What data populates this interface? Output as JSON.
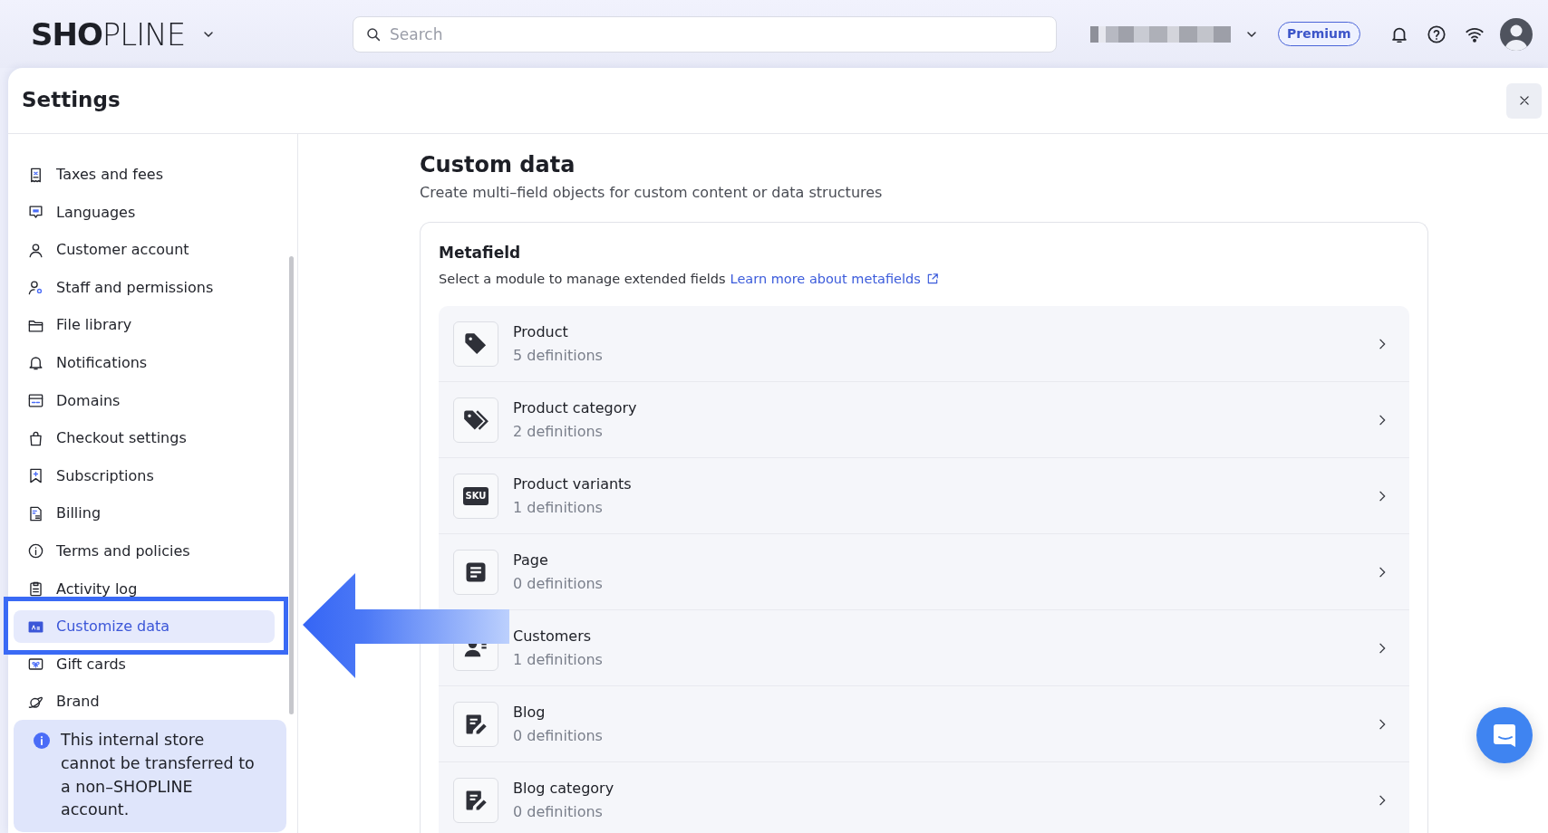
{
  "topbar": {
    "logo": "**SHO**PLINE",
    "search": {
      "placeholder": "Search"
    },
    "plan_badge": "Premium"
  },
  "settings": {
    "title": "Settings"
  },
  "sidebar": {
    "items": [
      {
        "label": "Taxes and fees",
        "selected": false
      },
      {
        "label": "Languages",
        "selected": false
      },
      {
        "label": "Customer account",
        "selected": false
      },
      {
        "label": "Staff and permissions",
        "selected": false
      },
      {
        "label": "File library",
        "selected": false
      },
      {
        "label": "Notifications",
        "selected": false
      },
      {
        "label": "Domains",
        "selected": false
      },
      {
        "label": "Checkout settings",
        "selected": false
      },
      {
        "label": "Subscriptions",
        "selected": false
      },
      {
        "label": "Billing",
        "selected": false
      },
      {
        "label": "Terms and policies",
        "selected": false
      },
      {
        "label": "Activity log",
        "selected": false
      },
      {
        "label": "Customize data",
        "selected": true
      },
      {
        "label": "Gift cards",
        "selected": false
      },
      {
        "label": "Brand",
        "selected": false
      }
    ],
    "notice": "This internal store cannot be transferred to a non–SHOPLINE account."
  },
  "content": {
    "title": "Custom data",
    "subtitle": "Create multi–field objects for custom content or data structures",
    "metafield": {
      "title": "Metafield",
      "description": "Select a module to manage extended fields",
      "link": "Learn more about metafields",
      "modules": [
        {
          "name": "Product",
          "count": "5 definitions"
        },
        {
          "name": "Product category",
          "count": "2 definitions"
        },
        {
          "name": "Product variants",
          "count": "1 definitions",
          "icon_label": "SKU"
        },
        {
          "name": "Page",
          "count": "0 definitions"
        },
        {
          "name": "Customers",
          "count": "1 definitions"
        },
        {
          "name": "Blog",
          "count": "0 definitions"
        },
        {
          "name": "Blog category",
          "count": "0 definitions"
        }
      ]
    }
  }
}
